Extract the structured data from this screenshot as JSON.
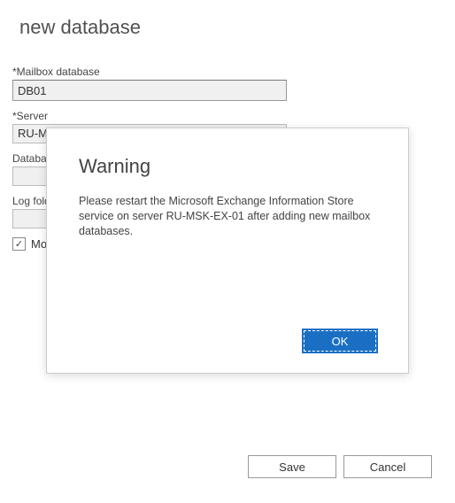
{
  "page": {
    "title": "new database"
  },
  "fields": {
    "mailbox_db": {
      "label": "*Mailbox database",
      "value": "DB01"
    },
    "server": {
      "label": "*Server",
      "value": "RU-MS"
    },
    "db_path": {
      "label": "Databas",
      "value": ""
    },
    "log_path": {
      "label": "Log fold",
      "value": ""
    },
    "mount_checkbox": {
      "label": "Mo",
      "checked": "✓"
    }
  },
  "buttons": {
    "save": "Save",
    "cancel": "Cancel"
  },
  "modal": {
    "title": "Warning",
    "message": "Please restart the Microsoft Exchange Information Store service on server RU-MSK-EX-01 after adding new mailbox databases.",
    "ok": "OK"
  }
}
